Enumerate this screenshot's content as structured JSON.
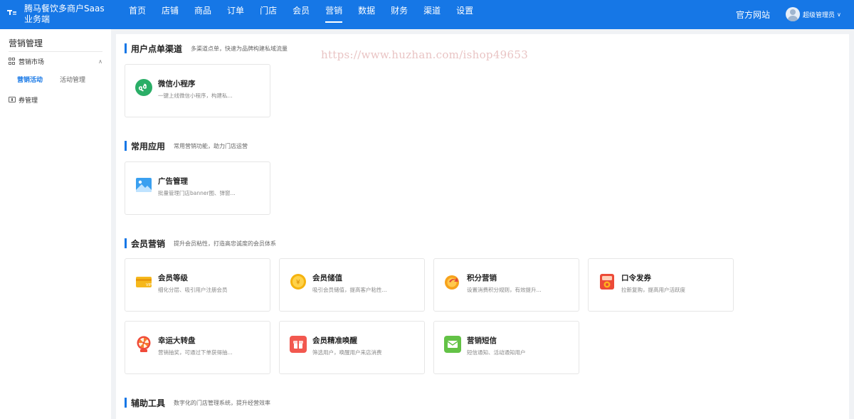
{
  "app": {
    "title": "腾马餐饮多商户Saas业务端"
  },
  "nav": {
    "items": [
      {
        "label": "首页"
      },
      {
        "label": "店铺"
      },
      {
        "label": "商品"
      },
      {
        "label": "订单"
      },
      {
        "label": "门店"
      },
      {
        "label": "会员"
      },
      {
        "label": "营销",
        "active": true
      },
      {
        "label": "数据"
      },
      {
        "label": "财务"
      },
      {
        "label": "渠道"
      },
      {
        "label": "设置"
      }
    ],
    "official_site": "官方网站",
    "user_name": "超级管理员"
  },
  "sidebar": {
    "title": "营销管理",
    "group_market": "营销市场",
    "sub_active": "营销活动",
    "sub_other": "活动管理",
    "group_coupon": "券管理"
  },
  "watermark": "https://www.huzhan.com/ishop49653",
  "sections": {
    "ordering": {
      "title": "用户点单渠道",
      "desc": "多渠道点单，快速为品牌构建私域流量",
      "cards": [
        {
          "title": "微信小程序",
          "desc": "一键上线微信小程序，构建私...",
          "icon": "mini-program-icon"
        }
      ]
    },
    "common": {
      "title": "常用应用",
      "desc": "常用营销功能，助力门店运营",
      "cards": [
        {
          "title": "广告管理",
          "desc": "批量管理门店banner图、弹窗...",
          "icon": "ad-image-icon"
        }
      ]
    },
    "member": {
      "title": "会员营销",
      "desc": "提升会员粘性，打造高忠诚度的会员体系",
      "cards": [
        {
          "title": "会员等级",
          "desc": "细化分层、吸引用户注册会员",
          "icon": "vip-card-icon"
        },
        {
          "title": "会员储值",
          "desc": "吸引会员储值，提高客户粘性...",
          "icon": "coin-icon"
        },
        {
          "title": "积分营销",
          "desc": "设置消费积分规则，有效提升...",
          "icon": "points-icon"
        },
        {
          "title": "口令发券",
          "desc": "拉新复购，提高用户活跃度",
          "icon": "coupon-envelope-icon"
        },
        {
          "title": "幸运大转盘",
          "desc": "营销抽奖，可通过下单获得抽...",
          "icon": "lucky-wheel-icon"
        },
        {
          "title": "会员精准唤醒",
          "desc": "筛选用户，唤醒用户来店消费",
          "icon": "wake-gift-icon"
        },
        {
          "title": "营销短信",
          "desc": "短信通知、活动通知用户",
          "icon": "sms-mail-icon"
        }
      ]
    },
    "tools": {
      "title": "辅助工具",
      "desc": "数字化的门店管理系统，提升经营效率"
    }
  },
  "colors": {
    "primary": "#1677e6",
    "page_bg": "#f0f2f5"
  }
}
